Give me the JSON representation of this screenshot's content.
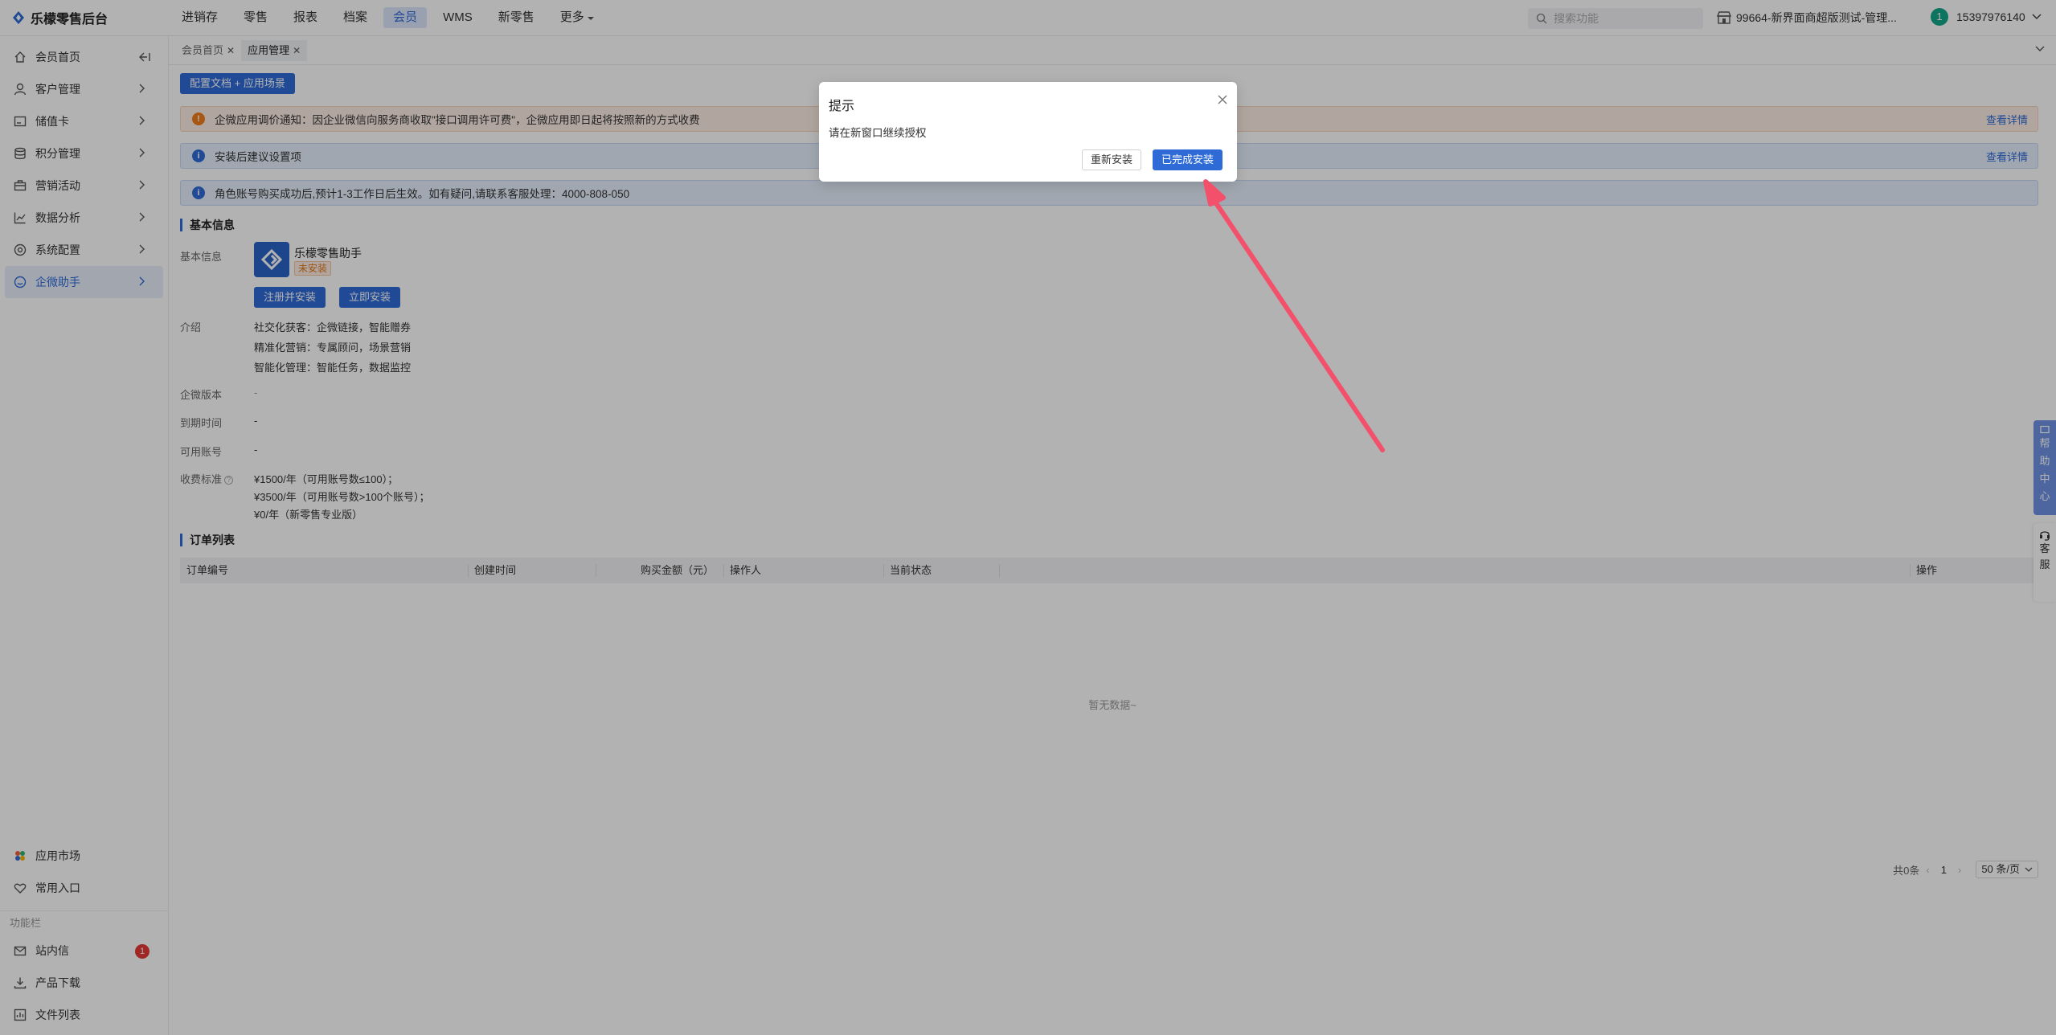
{
  "app": {
    "logo_text": "乐檬零售后台"
  },
  "topnav": {
    "items": [
      {
        "label": "进销存"
      },
      {
        "label": "零售"
      },
      {
        "label": "报表"
      },
      {
        "label": "档案"
      },
      {
        "label": "会员"
      },
      {
        "label": "WMS"
      },
      {
        "label": "新零售"
      },
      {
        "label": "更多"
      }
    ],
    "active_index": 4
  },
  "search": {
    "placeholder": "搜索功能"
  },
  "store": {
    "name": "99664-新界面商超版测试-管理..."
  },
  "user": {
    "avatar_letter": "1",
    "phone": "15397976140"
  },
  "sidebar": {
    "items": [
      {
        "label": "会员首页",
        "icon": "home-icon"
      },
      {
        "label": "客户管理",
        "icon": "user-icon"
      },
      {
        "label": "储值卡",
        "icon": "card-icon"
      },
      {
        "label": "积分管理",
        "icon": "database-icon"
      },
      {
        "label": "营销活动",
        "icon": "briefcase-icon"
      },
      {
        "label": "数据分析",
        "icon": "chart-icon"
      },
      {
        "label": "系统配置",
        "icon": "settings-icon"
      },
      {
        "label": "企微助手",
        "icon": "chat-icon"
      }
    ],
    "bottom_items": [
      {
        "label": "应用市场",
        "icon": "app-market-icon"
      },
      {
        "label": "常用入口",
        "icon": "heart-icon"
      }
    ],
    "section_label": "功能栏",
    "function_items": [
      {
        "label": "站内信",
        "icon": "mail-icon",
        "badge": "1"
      },
      {
        "label": "产品下载",
        "icon": "download-icon"
      },
      {
        "label": "文件列表",
        "icon": "file-icon"
      }
    ]
  },
  "tabs": [
    {
      "label": "会员首页"
    },
    {
      "label": "应用管理"
    }
  ],
  "main": {
    "config_button": "配置文档 + 应用场景",
    "notices": [
      {
        "text": "企微应用调价通知：因企业微信向服务商收取\"接口调用许可费\"，企微应用即日起将按照新的方式收费",
        "link": "查看详情",
        "type": "warn",
        "icon": "!"
      },
      {
        "text": "安装后建议设置项",
        "link": "查看详情",
        "type": "info",
        "icon": "i"
      },
      {
        "text": "角色账号购买成功后,预计1-3工作日后生效。如有疑问,请联系客服处理：4000-808-050",
        "link": "",
        "type": "info",
        "icon": "i"
      }
    ],
    "basic_info_title": "基本信息",
    "basic_info_label": "基本信息",
    "app_name": "乐檬零售助手",
    "app_status": "未安装",
    "register_install_button": "注册并安装",
    "install_now_button": "立即安装",
    "intro_label": "介绍",
    "intro_lines": [
      "社交化获客：企微链接，智能赠券",
      "精准化营销：专属顾问，场景营销",
      "智能化管理：智能任务，数据监控"
    ],
    "version_label": "企微版本",
    "version_value": "-",
    "expire_label": "到期时间",
    "expire_value": "-",
    "accounts_label": "可用账号",
    "accounts_value": "-",
    "fee_label": "收费标准",
    "fee_lines": [
      "¥1500/年（可用账号数≤100）；",
      "¥3500/年（可用账号数>100个账号）；",
      "¥0/年（新零售专业版）"
    ],
    "order_list_title": "订单列表",
    "table_headers": [
      "订单编号",
      "创建时间",
      "购买金额（元）",
      "操作人",
      "当前状态",
      "操作"
    ],
    "empty_text": "暂无数据~",
    "pagination": {
      "total": "共0条",
      "current_page": "1",
      "page_size": "50 条/页"
    }
  },
  "float_tabs": {
    "help": [
      "帮",
      "助",
      "中",
      "心"
    ],
    "service": [
      "客",
      "服"
    ]
  },
  "dialog": {
    "title": "提示",
    "message": "请在新窗口继续授权",
    "reinstall_button": "重新安装",
    "done_button": "已完成安装"
  },
  "colors": {
    "primary": "#2f6bd7",
    "warn": "#f07d1a",
    "annotation_arrow": "#f2506b"
  }
}
